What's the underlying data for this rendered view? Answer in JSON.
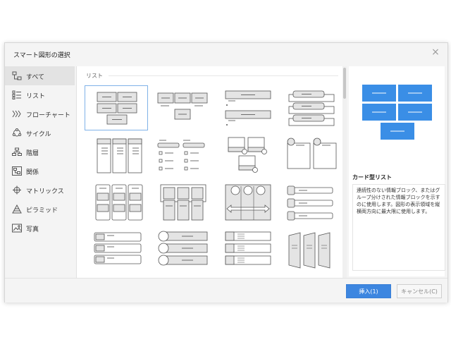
{
  "dialog": {
    "title": "スマート図形の選択",
    "close_glyph": "×"
  },
  "sidebar": {
    "items": [
      {
        "label": "すべて",
        "icon": "all-shapes-icon",
        "active": true
      },
      {
        "label": "リスト",
        "icon": "list-icon"
      },
      {
        "label": "フローチャート",
        "icon": "flowchart-icon"
      },
      {
        "label": "サイクル",
        "icon": "cycle-icon"
      },
      {
        "label": "階層",
        "icon": "hierarchy-icon"
      },
      {
        "label": "関係",
        "icon": "relationship-icon"
      },
      {
        "label": "マトリックス",
        "icon": "matrix-icon"
      },
      {
        "label": "ピラミッド",
        "icon": "pyramid-icon"
      },
      {
        "label": "写真",
        "icon": "photo-icon"
      }
    ]
  },
  "gallery": {
    "section_label": "リスト"
  },
  "preview": {
    "name": "カード型リスト",
    "description": "連続性のない情報ブロック、またはグループ分けされた情報ブロックを示すのに使用します。図形の表示領域を縦横両方向に最大限に使用します。"
  },
  "footer": {
    "insert_label": "挿入(1)",
    "cancel_label": "キャンセル(C)"
  },
  "colors": {
    "accent": "#3d86e0",
    "preview_shape": "#3a8ee6",
    "selection_border": "#7fb2e8"
  }
}
